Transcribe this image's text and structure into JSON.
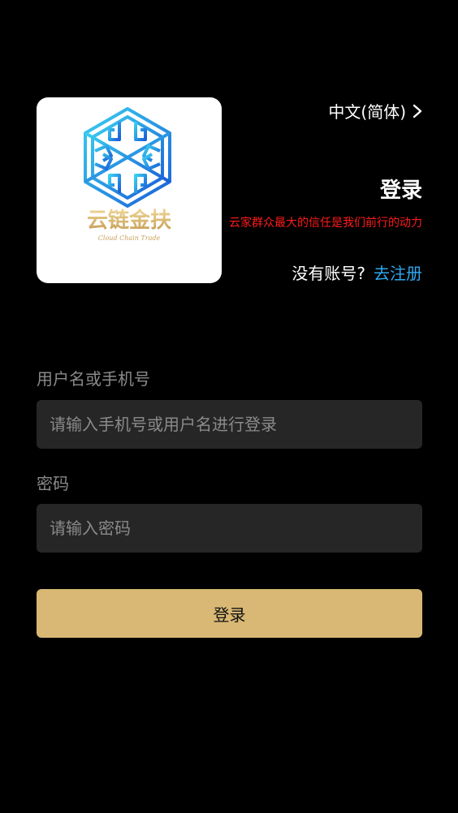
{
  "logo": {
    "brand_cn": "云链金扶",
    "brand_en": "Cloud Chain Trade"
  },
  "header": {
    "language": "中文(简体)",
    "title": "登录",
    "slogan": "云家群众最大的信任是我们前行的动力",
    "no_account": "没有账号?",
    "register_link": "去注册"
  },
  "form": {
    "username": {
      "label": "用户名或手机号",
      "placeholder": "请输入手机号或用户名进行登录",
      "value": ""
    },
    "password": {
      "label": "密码",
      "placeholder": "请输入密码",
      "value": ""
    },
    "submit_label": "登录"
  },
  "colors": {
    "background": "#000000",
    "accent_gold": "#d8b874",
    "link_blue": "#2fa8f0",
    "slogan_red": "#ff1a1a",
    "input_bg": "#262626"
  },
  "icons": {
    "language_arrow": "chevron-right-icon",
    "logo_mark": "snowflake-hexagon-icon"
  }
}
